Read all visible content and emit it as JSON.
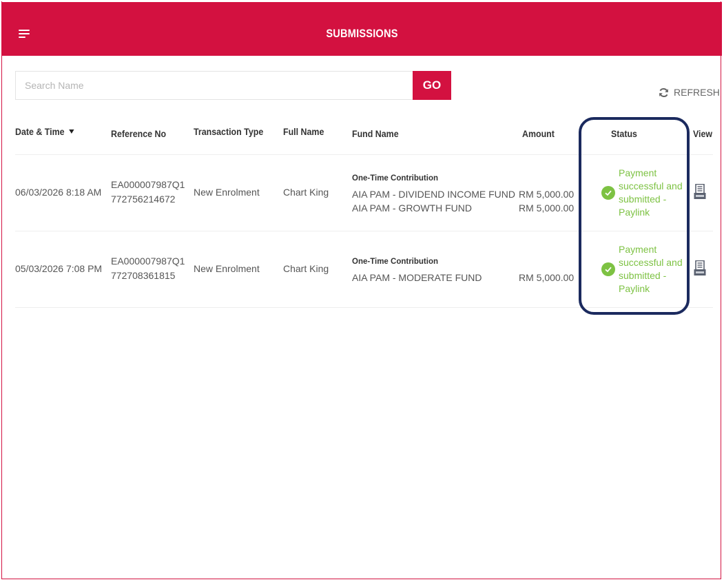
{
  "header": {
    "title": "SUBMISSIONS"
  },
  "search": {
    "placeholder": "Search Name",
    "value": "",
    "go_label": "GO"
  },
  "refresh_label": "REFRESH",
  "columns": {
    "date_time": "Date & Time",
    "reference_no": "Reference No",
    "transaction_type": "Transaction Type",
    "full_name": "Full Name",
    "fund_name": "Fund Name",
    "amount": "Amount",
    "status": "Status",
    "view": "View"
  },
  "rows": [
    {
      "date_time": "06/03/2026 8:18 AM",
      "reference_no": [
        "EA000007987Q1",
        "772756214672"
      ],
      "transaction_type": "New Enrolment",
      "full_name": "Chart King",
      "fund_heading": "One-Time Contribution",
      "funds": [
        "AIA PAM - DIVIDEND INCOME FUND",
        "AIA PAM - GROWTH FUND"
      ],
      "amounts": [
        "RM 5,000.00",
        "RM 5,000.00"
      ],
      "status": [
        "Payment",
        "successful and",
        "submitted -",
        "Paylink"
      ]
    },
    {
      "date_time": "05/03/2026 7:08 PM",
      "reference_no": [
        "EA000007987Q1",
        "772708361815"
      ],
      "transaction_type": "New Enrolment",
      "full_name": "Chart King",
      "fund_heading": "One-Time Contribution",
      "funds": [
        "AIA PAM - MODERATE FUND"
      ],
      "amounts": [
        "RM 5,000.00"
      ],
      "status": [
        "Payment",
        "successful and",
        "submitted -",
        "Paylink"
      ]
    }
  ],
  "colors": {
    "brand_red": "#d31140",
    "status_green": "#7dc243",
    "highlight_navy": "#1b2a5e"
  },
  "icons": {
    "menu": "hamburger-menu-icon",
    "refresh": "refresh-icon",
    "sort": "sort-down-triangle-icon",
    "status": "check-circle-icon",
    "view": "pdf-document-icon"
  }
}
